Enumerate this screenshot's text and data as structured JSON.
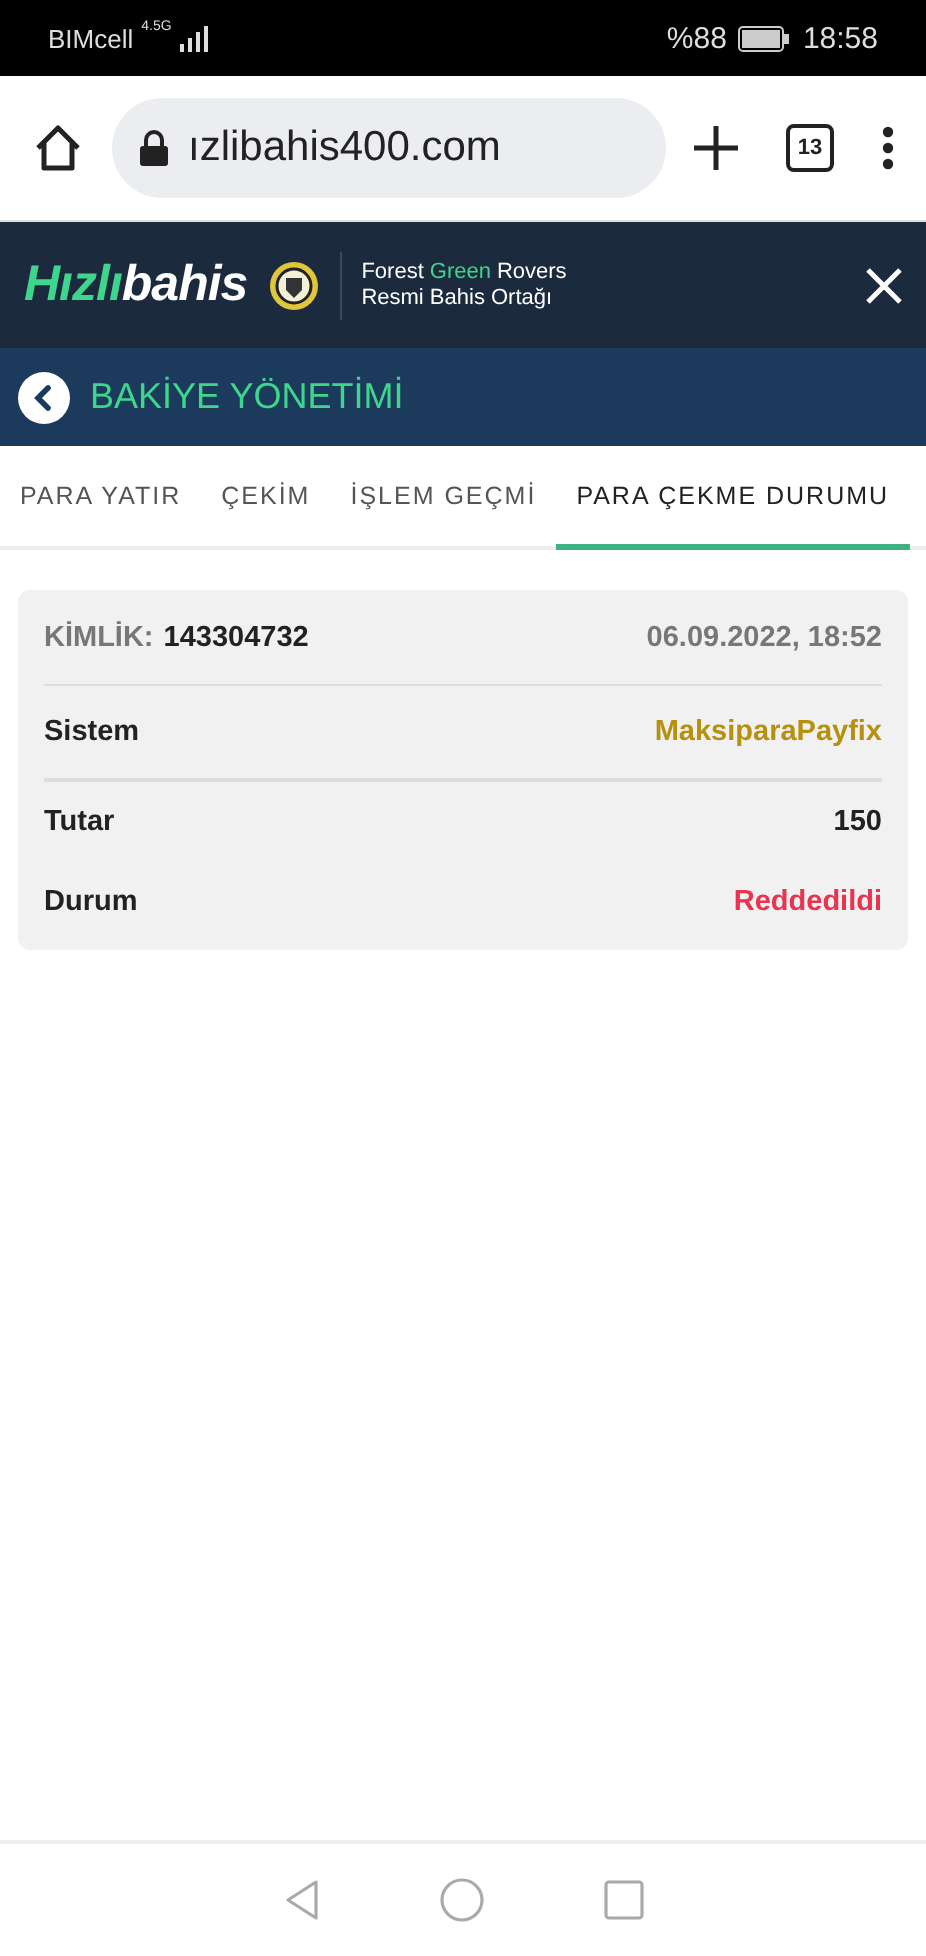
{
  "status_bar": {
    "carrier": "BIMcell",
    "network": "4.5G",
    "battery": "%88",
    "time": "18:58"
  },
  "browser": {
    "url": "ızlibahis400.com",
    "tab_count": "13"
  },
  "header": {
    "logo_parts": [
      {
        "text": "Hızlı",
        "highlight": true
      },
      {
        "text": "bahis",
        "highlight": false
      }
    ],
    "partner_parts": [
      {
        "text": "Forest",
        "highlight": false
      },
      {
        "text": "Green",
        "highlight": true
      },
      {
        "text": "Rovers",
        "highlight": false
      }
    ],
    "partner_tagline": "Resmi Bahis Ortağı"
  },
  "page_title": "BAKİYE YÖNETİMİ",
  "tabs": [
    {
      "label": "PARA YATIR",
      "selected": false
    },
    {
      "label": "ÇEKİM",
      "selected": false
    },
    {
      "label": "İŞLEM GEÇMİ",
      "selected": false
    },
    {
      "label": "PARA ÇEKME DURUMU",
      "selected": true
    }
  ],
  "withdrawal": {
    "id_label": "KİMLİK:",
    "id": "143304732",
    "date": "06.09.2022, 18:52",
    "rows": [
      {
        "label": "Sistem",
        "value": "MaksiparaPayfix",
        "color": "#b8900f",
        "divider": true
      },
      {
        "label": "Tutar",
        "value": "150",
        "color": "#222222",
        "divider": false
      },
      {
        "label": "Durum",
        "value": "Reddedildi",
        "color": "#e8344f",
        "divider": false
      }
    ]
  }
}
